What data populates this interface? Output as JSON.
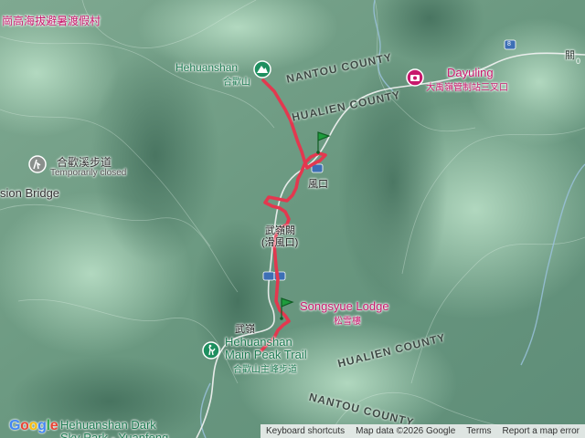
{
  "map": {
    "top_left_label": "崗高海拔避暑渡假村",
    "top_right_label": "關",
    "top_right_label2": "0",
    "route_badge": "8",
    "hehuanshan": {
      "en": "Hehuanshan",
      "zh": "合歡山"
    },
    "dayuling": {
      "en": "Dayuling",
      "zh": "大禹嶺管制站三叉口"
    },
    "nantou_county_top": "NANTOU COUNTY",
    "hualien_county_top": "HUALIEN COUNTY",
    "hehuan_trail_left": {
      "zh": "合歡溪步道",
      "note": "Temporarily closed"
    },
    "sion_bridge": "sion Bridge",
    "fengkou": "風口",
    "wuling_pass": {
      "line1": "武嶺闕",
      "line2": "(滑風口)"
    },
    "songsyue": {
      "en": "Songsyue Lodge",
      "zh": "松雪樓"
    },
    "wuling": "武嶺",
    "main_peak_trail": {
      "line1": "Hehuanshan",
      "line2": "Main Peak Trail",
      "zh": "合歡山主峰步道"
    },
    "hualien_county_bottom": "HUALIEN COUNTY",
    "nantou_county_bottom": "NANTOU COUNTY",
    "dark_sky": {
      "line1": "Hehuanshan Dark",
      "line2": "Sky Park - Yuanfeng"
    },
    "small_right": "0",
    "google_logo": "Google",
    "footer": {
      "keyboard": "Keyboard shortcuts",
      "mapdata": "Map data ©2026 Google",
      "terms": "Terms",
      "report": "Report a map error"
    },
    "colors": {
      "track": "#e3384f",
      "pin": "#1e9c3c",
      "poi_green": "#1e8f5f",
      "poi_pink": "#c8186c"
    }
  }
}
